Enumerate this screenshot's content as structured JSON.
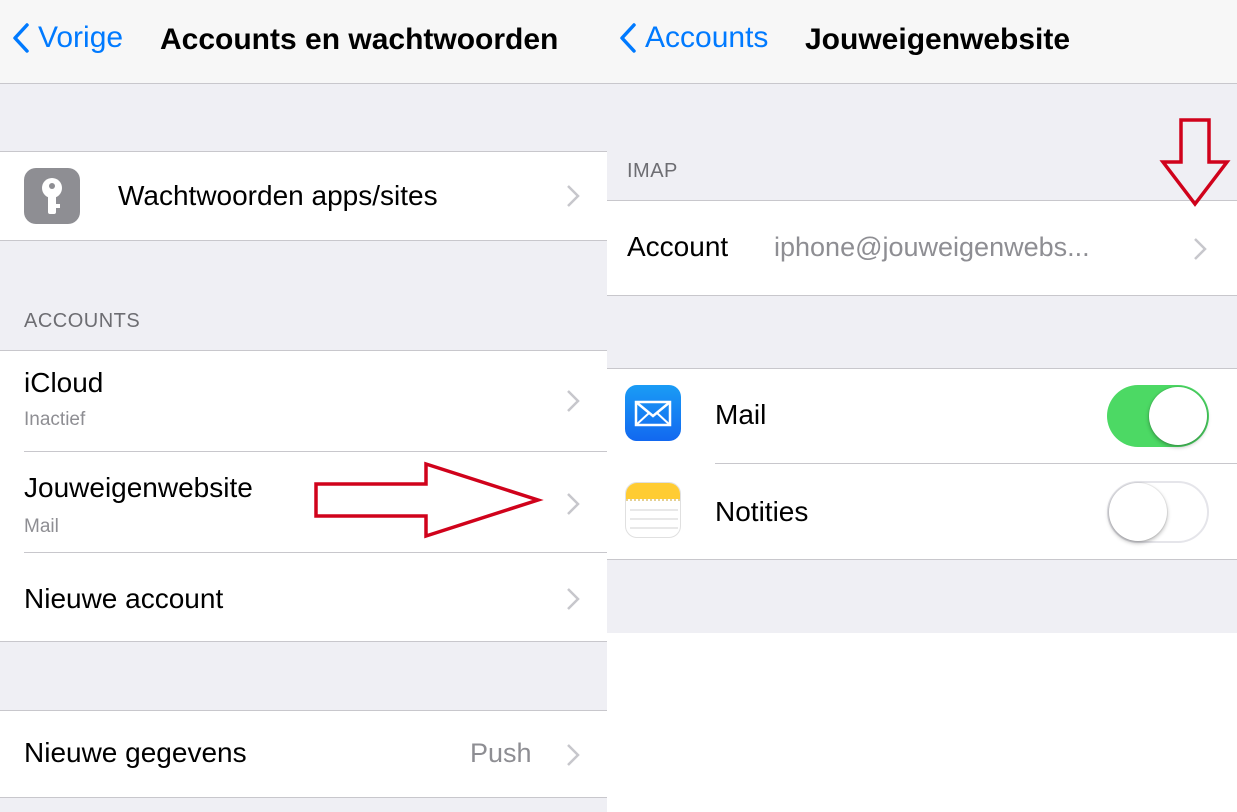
{
  "left": {
    "back_label": "Vorige",
    "title": "Accounts en wachtwoorden",
    "passwords_row": {
      "label": "Wachtwoorden apps/sites",
      "icon": "key-icon"
    },
    "accounts_header": "ACCOUNTS",
    "accounts": [
      {
        "title": "iCloud",
        "subtitle": "Inactief"
      },
      {
        "title": "Jouweigenwebsite",
        "subtitle": "Mail"
      },
      {
        "title": "Nieuwe account",
        "subtitle": ""
      }
    ],
    "fetch_row": {
      "label": "Nieuwe gegevens",
      "value": "Push"
    }
  },
  "right": {
    "back_label": "Accounts",
    "title": "Jouweigenwebsite",
    "imap_header": "IMAP",
    "account_row": {
      "label": "Account",
      "value": "iphone@jouweigenwebs..."
    },
    "toggles": [
      {
        "label": "Mail",
        "icon": "mail-app-icon",
        "on": true
      },
      {
        "label": "Notities",
        "icon": "notes-app-icon",
        "on": false
      }
    ]
  },
  "colors": {
    "ios_blue": "#007aff",
    "toggle_green": "#4cd964",
    "annotation_red": "#d0021b",
    "grouped_bg": "#efeff4"
  }
}
